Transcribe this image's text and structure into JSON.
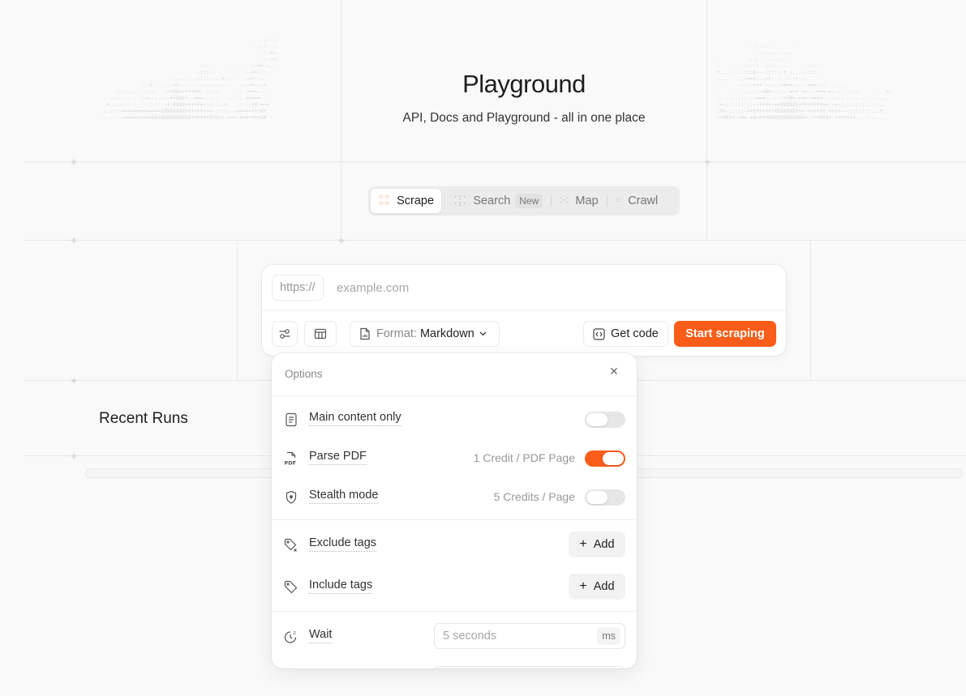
{
  "hero": {
    "title": "Playground",
    "subtitle": "API, Docs and Playground - all in one place"
  },
  "tabs": [
    {
      "label": "Scrape",
      "icon": "dots-grid-icon",
      "active": true
    },
    {
      "label": "Search",
      "icon": "dots-scatter-icon",
      "badge": "New"
    },
    {
      "label": "Map",
      "icon": "dots-map-icon"
    },
    {
      "label": "Crawl",
      "icon": "dots-crawl-icon"
    }
  ],
  "scrape": {
    "protocol": "https://",
    "url_placeholder": "example.com",
    "format_label": "Format:",
    "format_value": "Markdown",
    "get_code_label": "Get code",
    "start_label": "Start scraping"
  },
  "recent": {
    "title": "Recent Runs"
  },
  "options": {
    "title": "Options",
    "close_icon": "close-icon",
    "toggles": [
      {
        "label": "Main content only",
        "meta": "",
        "on": false,
        "icon": "document-icon"
      },
      {
        "label": "Parse PDF",
        "meta": "1 Credit / PDF Page",
        "on": true,
        "icon": "pdf-icon"
      },
      {
        "label": "Stealth mode",
        "meta": "5 Credits / Page",
        "on": false,
        "icon": "shield-icon"
      }
    ],
    "tags": [
      {
        "label": "Exclude tags",
        "add_label": "Add",
        "icon": "tag-x-icon"
      },
      {
        "label": "Include tags",
        "add_label": "Add",
        "icon": "tag-icon"
      }
    ],
    "wait": {
      "label": "Wait",
      "placeholder": "5 seconds",
      "unit": "ms",
      "icon": "timer-icon"
    }
  },
  "colors": {
    "accent": "#fa5d19",
    "background": "#f9f9f9"
  }
}
